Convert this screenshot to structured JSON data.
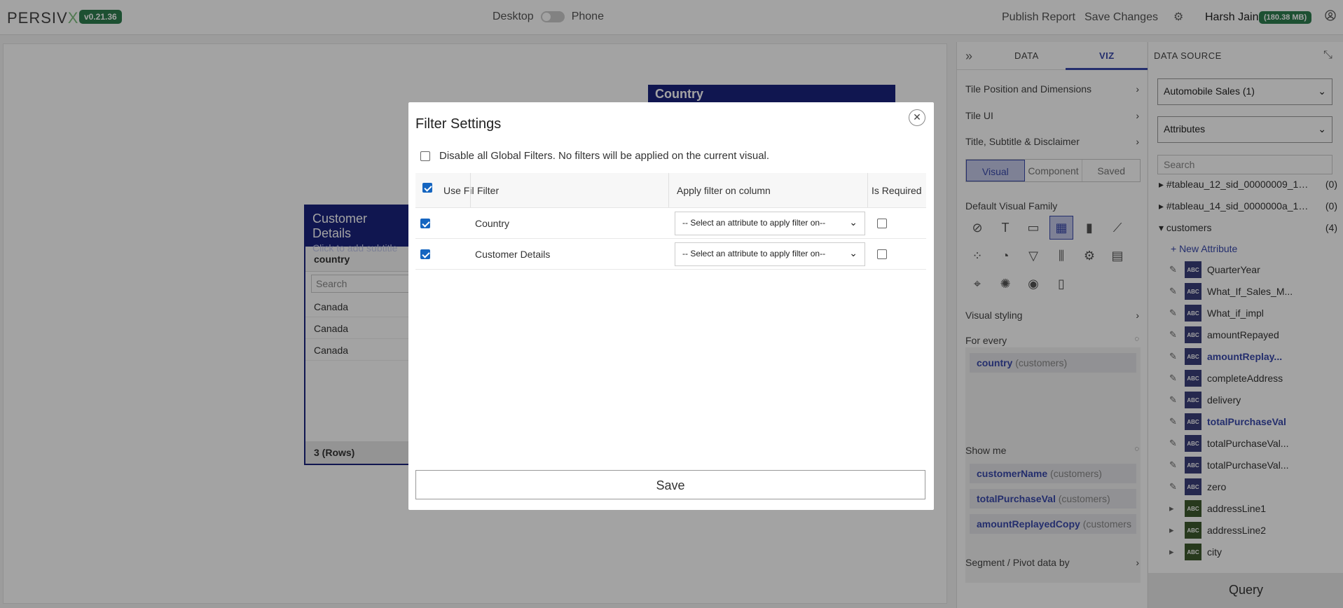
{
  "topbar": {
    "logo": "PERSIV",
    "logo_x": "X",
    "version": "v0.21.36",
    "desktop_label": "Desktop",
    "phone_label": "Phone",
    "publish_label": "Publish Report",
    "save_changes_label": "Save Changes",
    "user_name": "Harsh Jain",
    "memory": "(180.38 MB)"
  },
  "canvas": {
    "country_tile_title": "Country",
    "customer_tile": {
      "title": "Customer Details",
      "subtitle": "Click to add subtitle",
      "column": "country",
      "search_placeholder": "Search",
      "rows": [
        "Canada",
        "Canada",
        "Canada"
      ],
      "footer": "3 (Rows)"
    }
  },
  "viz_panel": {
    "tabs": {
      "data": "DATA",
      "viz": "VIZ"
    },
    "sections": {
      "tile_position": "Tile Position and Dimensions",
      "tile_ui": "Tile UI",
      "title_subtitle": "Title, Subtitle & Disclaimer"
    },
    "segments": {
      "visual": "Visual",
      "component": "Component",
      "saved": "Saved"
    },
    "default_visual_family": "Default Visual Family",
    "visual_styling": "Visual styling",
    "for_every": {
      "label": "For every",
      "pill_name": "country",
      "pill_source": "(customers)"
    },
    "show_me": {
      "label": "Show me",
      "pills": [
        {
          "name": "customerName",
          "source": "(customers)"
        },
        {
          "name": "totalPurchaseVal",
          "source": "(customers)"
        },
        {
          "name": "amountReplayedCopy",
          "source": "(customers"
        }
      ]
    },
    "segment_pivot": "Segment / Pivot data by"
  },
  "data_source": {
    "title": "DATA SOURCE",
    "source_select": "Automobile Sales (1)",
    "type_select": "Attributes",
    "search_placeholder": "Search",
    "tree": [
      {
        "name": "#tableau_12_sid_00000009_1_gr...",
        "count": "(0)"
      },
      {
        "name": "#tableau_14_sid_0000000a_1_gr...",
        "count": "(0)"
      },
      {
        "name": "customers",
        "count": "(4)"
      }
    ],
    "new_attribute": "+ New Attribute",
    "abc": "ABC",
    "attributes": [
      {
        "name": "QuarterYear"
      },
      {
        "name": "What_If_Sales_M..."
      },
      {
        "name": "What_if_impl"
      },
      {
        "name": "amountRepayed"
      },
      {
        "name": "amountReplay..."
      },
      {
        "name": "completeAddress"
      },
      {
        "name": "delivery"
      },
      {
        "name": "totalPurchaseVal"
      },
      {
        "name": "totalPurchaseVal..."
      },
      {
        "name": "totalPurchaseVal..."
      },
      {
        "name": "zero"
      },
      {
        "name": "addressLine1"
      },
      {
        "name": "addressLine2"
      },
      {
        "name": "city"
      }
    ],
    "query_label": "Query"
  },
  "modal": {
    "title": "Filter Settings",
    "disable_global": "Disable all Global Filters. No filters will be applied on the current visual.",
    "headers": {
      "use_filter": "Use Fil",
      "filter": "Filter",
      "apply_on_column": "Apply filter on column",
      "is_required": "Is Required"
    },
    "select_placeholder": "-- Select an attribute to apply filter on--",
    "rows": [
      {
        "filter": "Country"
      },
      {
        "filter": "Customer Details"
      }
    ],
    "save_label": "Save"
  },
  "icons": [
    "close-icon",
    "settings-gear-icon",
    "user-icon",
    "chevron-right-icon",
    "chevron-down-icon",
    "pencil-icon",
    "collapse-icon"
  ]
}
